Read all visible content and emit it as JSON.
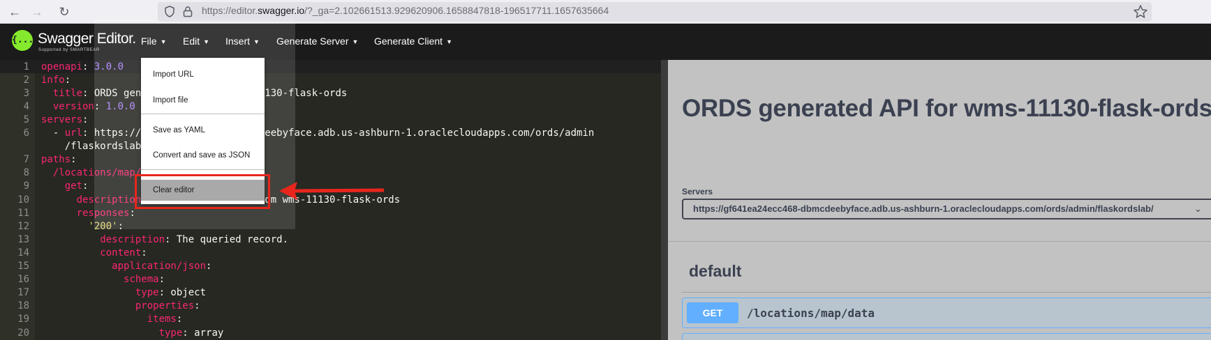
{
  "browser": {
    "url_prefix": "https://editor.",
    "url_domain": "swagger.io",
    "url_rest": "/?_ga=2.102661513.929620906.1658847818-196517711.1657635664",
    "icons": [
      "back-arrow-icon",
      "forward-arrow-icon",
      "reload-icon",
      "shield-icon",
      "lock-icon",
      "star-icon"
    ]
  },
  "header": {
    "logo_glyph": "{...}",
    "logo_name": "Swagger Editor.",
    "logo_sub": "Supported by SMARTBEAR",
    "menus": [
      {
        "label": "File"
      },
      {
        "label": "Edit"
      },
      {
        "label": "Insert"
      },
      {
        "label": "Generate Server"
      },
      {
        "label": "Generate Client"
      }
    ]
  },
  "file_menu": {
    "items": [
      {
        "label": "Import URL"
      },
      {
        "label": "Import file"
      },
      {
        "label": "Save as YAML"
      },
      {
        "label": "Convert and save as JSON"
      },
      {
        "label": "Clear editor"
      }
    ]
  },
  "editor": {
    "lines": [
      {
        "n": "1",
        "parts": [
          [
            "k",
            "openapi"
          ],
          [
            "s",
            ": "
          ],
          [
            "n",
            "3.0.0"
          ]
        ]
      },
      {
        "n": "2",
        "parts": [
          [
            "k",
            "info"
          ],
          [
            "s",
            ":"
          ]
        ]
      },
      {
        "n": "3",
        "parts": [
          [
            "k",
            "  title"
          ],
          [
            "s",
            ": ORDS generated API for wms-11130-flask-ords"
          ]
        ]
      },
      {
        "n": "4",
        "parts": [
          [
            "k",
            "  version"
          ],
          [
            "s",
            ": "
          ],
          [
            "n",
            "1.0.0"
          ]
        ]
      },
      {
        "n": "5",
        "parts": [
          [
            "k",
            "servers"
          ],
          [
            "s",
            ":"
          ]
        ]
      },
      {
        "n": "6",
        "parts": [
          [
            "s",
            "  - "
          ],
          [
            "k",
            "url"
          ],
          [
            "s",
            ": https://gf641ea24ecc468-dbmcdeebyface.adb.us-ashburn-1.oraclecloudapps.com/ords/admin"
          ]
        ]
      },
      {
        "n": "",
        "parts": [
          [
            "s",
            "    /flaskordslab/"
          ]
        ]
      },
      {
        "n": "7",
        "parts": [
          [
            "k",
            "paths"
          ],
          [
            "s",
            ":"
          ]
        ]
      },
      {
        "n": "8",
        "parts": [
          [
            "k",
            "  /locations/map/data"
          ],
          [
            "s",
            ":"
          ]
        ]
      },
      {
        "n": "9",
        "parts": [
          [
            "k",
            "    get"
          ],
          [
            "s",
            ":"
          ]
        ]
      },
      {
        "n": "10",
        "parts": [
          [
            "k",
            "      description"
          ],
          [
            "s",
            ": Retrieve records from wms-11130-flask-ords"
          ]
        ]
      },
      {
        "n": "11",
        "parts": [
          [
            "k",
            "      responses"
          ],
          [
            "s",
            ":"
          ]
        ]
      },
      {
        "n": "12",
        "parts": [
          [
            "s",
            "        "
          ],
          [
            "q",
            "'200'"
          ],
          [
            "s",
            ":"
          ]
        ]
      },
      {
        "n": "13",
        "parts": [
          [
            "k",
            "          description"
          ],
          [
            "s",
            ": The queried record."
          ]
        ]
      },
      {
        "n": "14",
        "parts": [
          [
            "k",
            "          content"
          ],
          [
            "s",
            ":"
          ]
        ]
      },
      {
        "n": "15",
        "parts": [
          [
            "k",
            "            application/json"
          ],
          [
            "s",
            ":"
          ]
        ]
      },
      {
        "n": "16",
        "parts": [
          [
            "k",
            "              schema"
          ],
          [
            "s",
            ":"
          ]
        ]
      },
      {
        "n": "17",
        "parts": [
          [
            "k",
            "                type"
          ],
          [
            "s",
            ": object"
          ]
        ]
      },
      {
        "n": "18",
        "parts": [
          [
            "k",
            "                properties"
          ],
          [
            "s",
            ":"
          ]
        ]
      },
      {
        "n": "19",
        "parts": [
          [
            "k",
            "                  items"
          ],
          [
            "s",
            ":"
          ]
        ]
      },
      {
        "n": "20",
        "parts": [
          [
            "k",
            "                    type"
          ],
          [
            "s",
            ": array"
          ]
        ]
      }
    ]
  },
  "preview": {
    "title": "ORDS generated API for wms-11130-flask-ords",
    "servers_label": "Servers",
    "server_url": "https://gf641ea24ecc468-dbmcdeebyface.adb.us-ashburn-1.oraclecloudapps.com/ords/admin/flaskordslab/",
    "section": "default",
    "operation": {
      "method": "GET",
      "path": "/locations/map/data"
    }
  },
  "colors": {
    "highlight": "#e8261c",
    "get": "#61affe",
    "logo": "#85ea2d"
  }
}
